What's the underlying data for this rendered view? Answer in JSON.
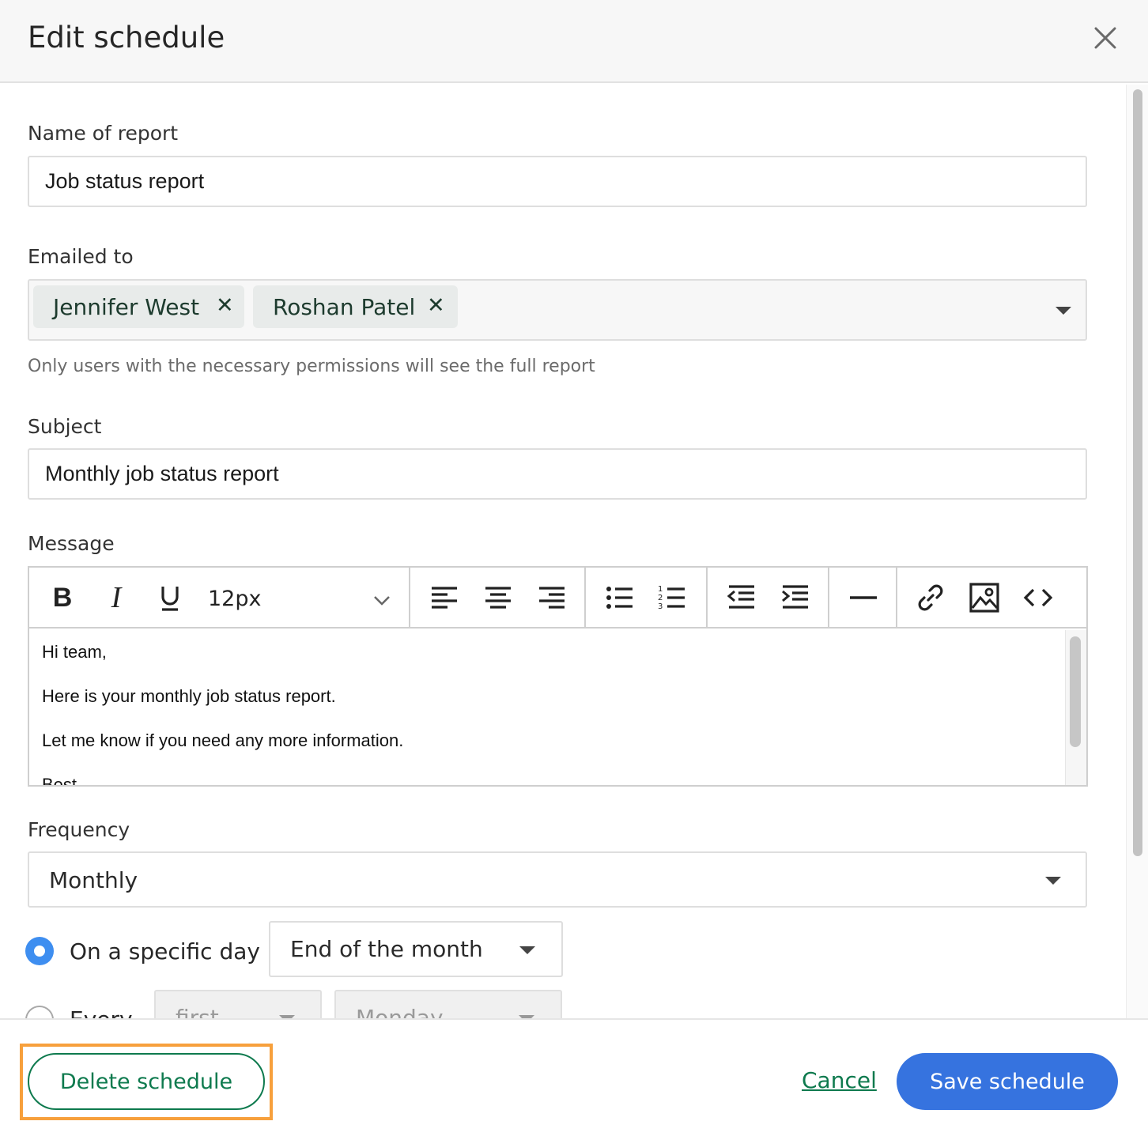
{
  "dialog": {
    "title": "Edit schedule"
  },
  "form": {
    "name": {
      "label": "Name of report",
      "value": "Job status report"
    },
    "emailed_to": {
      "label": "Emailed to",
      "recipients": [
        "Jennifer West",
        "Roshan Patel"
      ],
      "help": "Only users with the necessary permissions will see the full report"
    },
    "subject": {
      "label": "Subject",
      "value": "Monthly job status report"
    },
    "message": {
      "label": "Message",
      "font_size": "12px",
      "lines": [
        "Hi team,",
        "Here is your monthly job status report.",
        "Let me know if you need any more information.",
        "Best"
      ]
    },
    "frequency": {
      "label": "Frequency",
      "value": "Monthly",
      "option_specific_day": {
        "label": "On a specific day",
        "value": "End of the month",
        "selected": true
      },
      "option_every": {
        "label": "Every",
        "ordinal": "first",
        "weekday": "Monday",
        "selected": false
      }
    }
  },
  "footer": {
    "delete_label": "Delete schedule",
    "cancel_label": "Cancel",
    "save_label": "Save schedule"
  },
  "colors": {
    "primary_button": "#3673df",
    "brand_green": "#0e7a4e",
    "radio_selected": "#3e8ef0",
    "highlight": "#f7a03c"
  }
}
